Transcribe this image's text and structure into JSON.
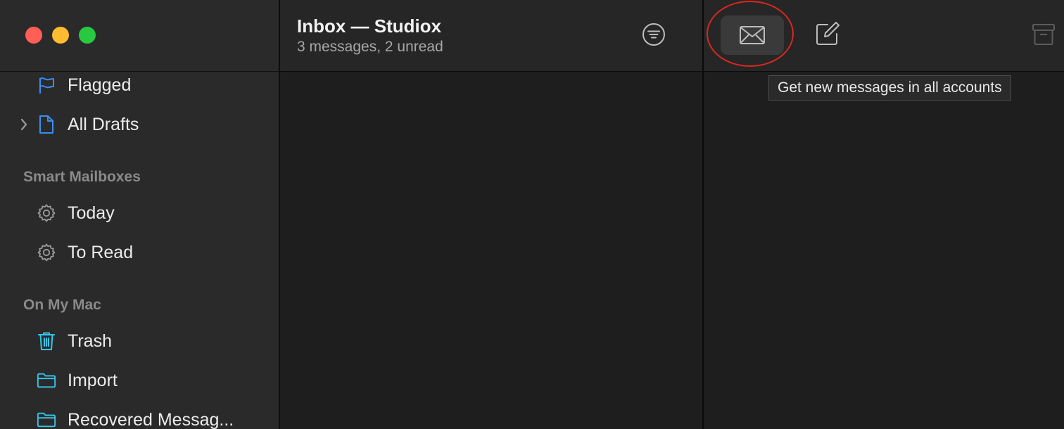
{
  "window": {
    "controls": [
      "close",
      "minimize",
      "zoom"
    ]
  },
  "sidebar": {
    "items_top": [
      {
        "label": "Flagged",
        "icon": "flag-icon"
      },
      {
        "label": "All Drafts",
        "icon": "draft-document-icon",
        "expandable": true
      }
    ],
    "sections": [
      {
        "header": "Smart Mailboxes",
        "items": [
          {
            "label": "Today",
            "icon": "gear-icon"
          },
          {
            "label": "To Read",
            "icon": "gear-icon"
          }
        ]
      },
      {
        "header": "On My Mac",
        "items": [
          {
            "label": "Trash",
            "icon": "trash-icon"
          },
          {
            "label": "Import",
            "icon": "folder-icon"
          },
          {
            "label": "Recovered Messag...",
            "icon": "folder-icon"
          }
        ]
      }
    ]
  },
  "message_list": {
    "title": "Inbox — Studiox",
    "subtitle": "3 messages, 2 unread"
  },
  "toolbar": {
    "get_mail_icon": "envelope-icon",
    "compose_icon": "compose-icon",
    "archive_icon": "archive-icon",
    "tooltip": "Get new messages in all accounts"
  },
  "colors": {
    "accent_blue": "#3b8ef0",
    "folder_cyan": "#35c5e8",
    "highlight_ring": "#d8281f"
  }
}
